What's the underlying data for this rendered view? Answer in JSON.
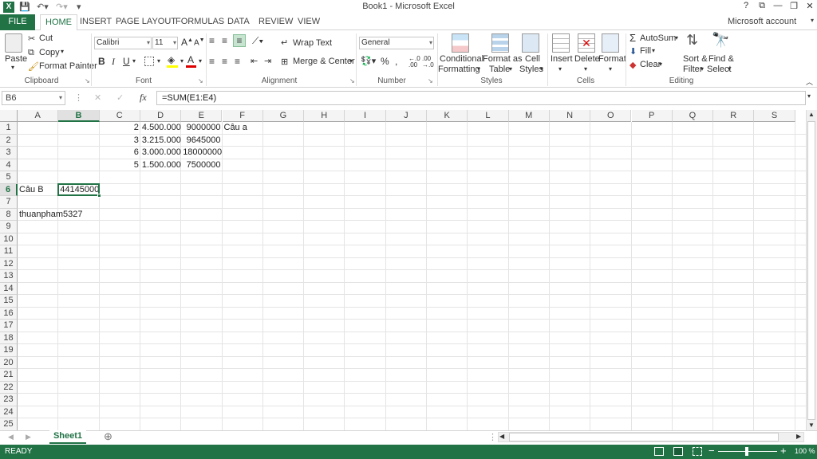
{
  "app": {
    "title": "Book1 - Microsoft Excel",
    "account": "Microsoft account"
  },
  "tabs": [
    "FILE",
    "HOME",
    "INSERT",
    "PAGE LAYOUT",
    "FORMULAS",
    "DATA",
    "REVIEW",
    "VIEW"
  ],
  "ribbon": {
    "clipboard": {
      "paste": "Paste",
      "cut": "Cut",
      "copy": "Copy",
      "format_painter": "Format Painter",
      "label": "Clipboard"
    },
    "font": {
      "name": "Calibri",
      "size": "11",
      "bold": "B",
      "italic": "I",
      "underline": "U",
      "label": "Font"
    },
    "alignment": {
      "wrap": "Wrap Text",
      "merge": "Merge & Center",
      "label": "Alignment"
    },
    "number": {
      "format": "General",
      "label": "Number"
    },
    "styles": {
      "conditional1": "Conditional",
      "conditional2": "Formatting",
      "format_table1": "Format as",
      "format_table2": "Table",
      "cell_styles1": "Cell",
      "cell_styles2": "Styles",
      "label": "Styles"
    },
    "cells": {
      "insert": "Insert",
      "delete": "Delete",
      "format": "Format",
      "label": "Cells"
    },
    "editing": {
      "autosum": "AutoSum",
      "fill": "Fill",
      "clear": "Clear",
      "sort1": "Sort &",
      "sort2": "Filter",
      "find1": "Find &",
      "find2": "Select",
      "label": "Editing"
    }
  },
  "formula": {
    "namebox": "B6",
    "fx": "fx",
    "content": "=SUM(E1:E4)"
  },
  "columns": [
    "A",
    "B",
    "C",
    "D",
    "E",
    "F",
    "G",
    "H",
    "I",
    "J",
    "K",
    "L",
    "M",
    "N",
    "O",
    "P",
    "Q",
    "R",
    "S"
  ],
  "rows": [
    "1",
    "2",
    "3",
    "4",
    "5",
    "6",
    "7",
    "8",
    "9",
    "10",
    "11",
    "12",
    "13",
    "14",
    "15",
    "16",
    "17",
    "18",
    "19",
    "20",
    "21",
    "22",
    "23",
    "24",
    "25"
  ],
  "cells": {
    "C1": "2",
    "D1": "4.500.000",
    "E1": "9000000",
    "F1": "Câu a",
    "C2": "3",
    "D2": "3.215.000",
    "E2": "9645000",
    "C3": "6",
    "D3": "3.000.000",
    "E3": "18000000",
    "C4": "5",
    "D4": "1.500.000",
    "E4": "7500000",
    "A6": "Câu B",
    "B6": "44145000",
    "A8": "thuanpham5327"
  },
  "sheet": {
    "name": "Sheet1"
  },
  "status": {
    "left": "READY",
    "zoom": "100 %"
  },
  "colors": {
    "accent": "#217346"
  }
}
